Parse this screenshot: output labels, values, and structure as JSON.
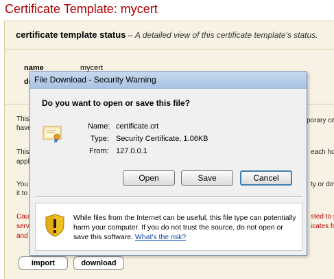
{
  "page": {
    "title": "Certificate Template: mycert",
    "status_heading": "certificate template status",
    "status_sep": "--",
    "status_subtitle": "A detailed view of this certificate template's status.",
    "name_label": "name",
    "name_value": "mycert",
    "desc_label_partial": "de",
    "para_fragments": [
      {
        "text": "This",
        "red": false
      },
      {
        "text": "have",
        "red": false
      },
      {
        "text": "This",
        "red": false
      },
      {
        "text": "appl",
        "red": false
      },
      {
        "text": "You",
        "red": false
      },
      {
        "text": "it to",
        "red": false
      },
      {
        "text": "Cau",
        "red": true
      },
      {
        "text": "serv",
        "red": true
      },
      {
        "text": "and",
        "red": true
      }
    ],
    "right_fragments": [
      {
        "text": "porary ce",
        "red": false
      },
      {
        "text": "each ho",
        "red": false
      },
      {
        "text": "ty or dow",
        "red": false
      },
      {
        "text": "sted to s",
        "red": true
      },
      {
        "text": "icates fo",
        "red": true
      }
    ],
    "import_button": "import",
    "download_button": "download"
  },
  "dialog": {
    "title": "File Download - Security Warning",
    "question": "Do you want to open or save this file?",
    "name_label": "Name:",
    "name_value": "certificate.crt",
    "type_label": "Type:",
    "type_value": "Security Certificate, 1.06KB",
    "from_label": "From:",
    "from_value": "127.0.0.1",
    "open_button": "Open",
    "save_button": "Save",
    "cancel_button": "Cancel",
    "warning_text": "While files from the Internet can be useful, this file type can potentially harm your computer. If you do not trust the source, do not open or save this software.",
    "risk_link": "What's the risk?"
  },
  "icons": [
    "certificate-icon",
    "shield-warning-icon"
  ],
  "colors": {
    "title_red": "#b00000",
    "panel_bg": "#f7f2e3",
    "link": "#0645ad"
  }
}
